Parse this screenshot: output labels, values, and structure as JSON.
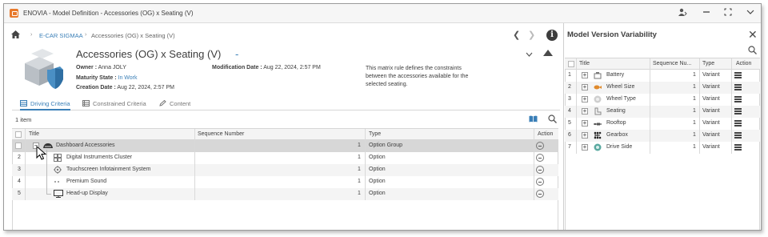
{
  "window": {
    "title": "ENOVIA - Model Definition - Accessories (OG) x Seating (V)"
  },
  "breadcrumb": {
    "items": [
      "E-CAR SIGMAA",
      "Accessories (OG) x Seating (V)"
    ]
  },
  "header": {
    "title": "Accessories (OG) x Seating (V)",
    "title_suffix": "-",
    "owner_label": "Owner :",
    "owner_value": "Anna JOLY",
    "maturity_label": "Maturity State :",
    "maturity_value": "In Work",
    "creation_label": "Creation Date :",
    "creation_value": "Aug 22, 2024, 2:57 PM",
    "modification_label": "Modification Date :",
    "modification_value": "Aug 22, 2024, 2:57 PM",
    "description": "This matrix rule defines the constraints between the accessories available for the selected seating."
  },
  "tabs": [
    {
      "label": "Driving Criteria",
      "active": true
    },
    {
      "label": "Constrained Criteria",
      "active": false
    },
    {
      "label": "Content",
      "active": false
    }
  ],
  "left_table": {
    "count_label": "1 item",
    "columns": [
      "Title",
      "Sequence Number",
      "Type",
      "Action"
    ],
    "rows": [
      {
        "num": "",
        "title": "Dashboard Accessories",
        "seq": "1",
        "type": "Option Group"
      },
      {
        "num": "2",
        "title": "Digital Instruments Cluster",
        "seq": "1",
        "type": "Option"
      },
      {
        "num": "3",
        "title": "Touchscreen Infotainment System",
        "seq": "1",
        "type": "Option"
      },
      {
        "num": "4",
        "title": "Premium Sound",
        "seq": "1",
        "type": "Option"
      },
      {
        "num": "5",
        "title": "Head-up Display",
        "seq": "1",
        "type": "Option"
      }
    ]
  },
  "right_panel": {
    "title": "Model Version Variability",
    "columns": [
      "Title",
      "Sequence Nu...",
      "Type",
      "Action"
    ],
    "rows": [
      {
        "num": "1",
        "title": "Battery",
        "seq": "1",
        "type": "Variant"
      },
      {
        "num": "2",
        "title": "Wheel Size",
        "seq": "1",
        "type": "Variant"
      },
      {
        "num": "3",
        "title": "Wheel Type",
        "seq": "1",
        "type": "Variant"
      },
      {
        "num": "4",
        "title": "Seating",
        "seq": "1",
        "type": "Variant"
      },
      {
        "num": "5",
        "title": "Rooftop",
        "seq": "1",
        "type": "Variant"
      },
      {
        "num": "6",
        "title": "Gearbox",
        "seq": "1",
        "type": "Variant"
      },
      {
        "num": "7",
        "title": "Drive Side",
        "seq": "1",
        "type": "Variant"
      }
    ]
  },
  "colors": {
    "accent": "#3a7fb7",
    "app_logo": "#e8792b",
    "selected_row": "#d7d7d7"
  }
}
